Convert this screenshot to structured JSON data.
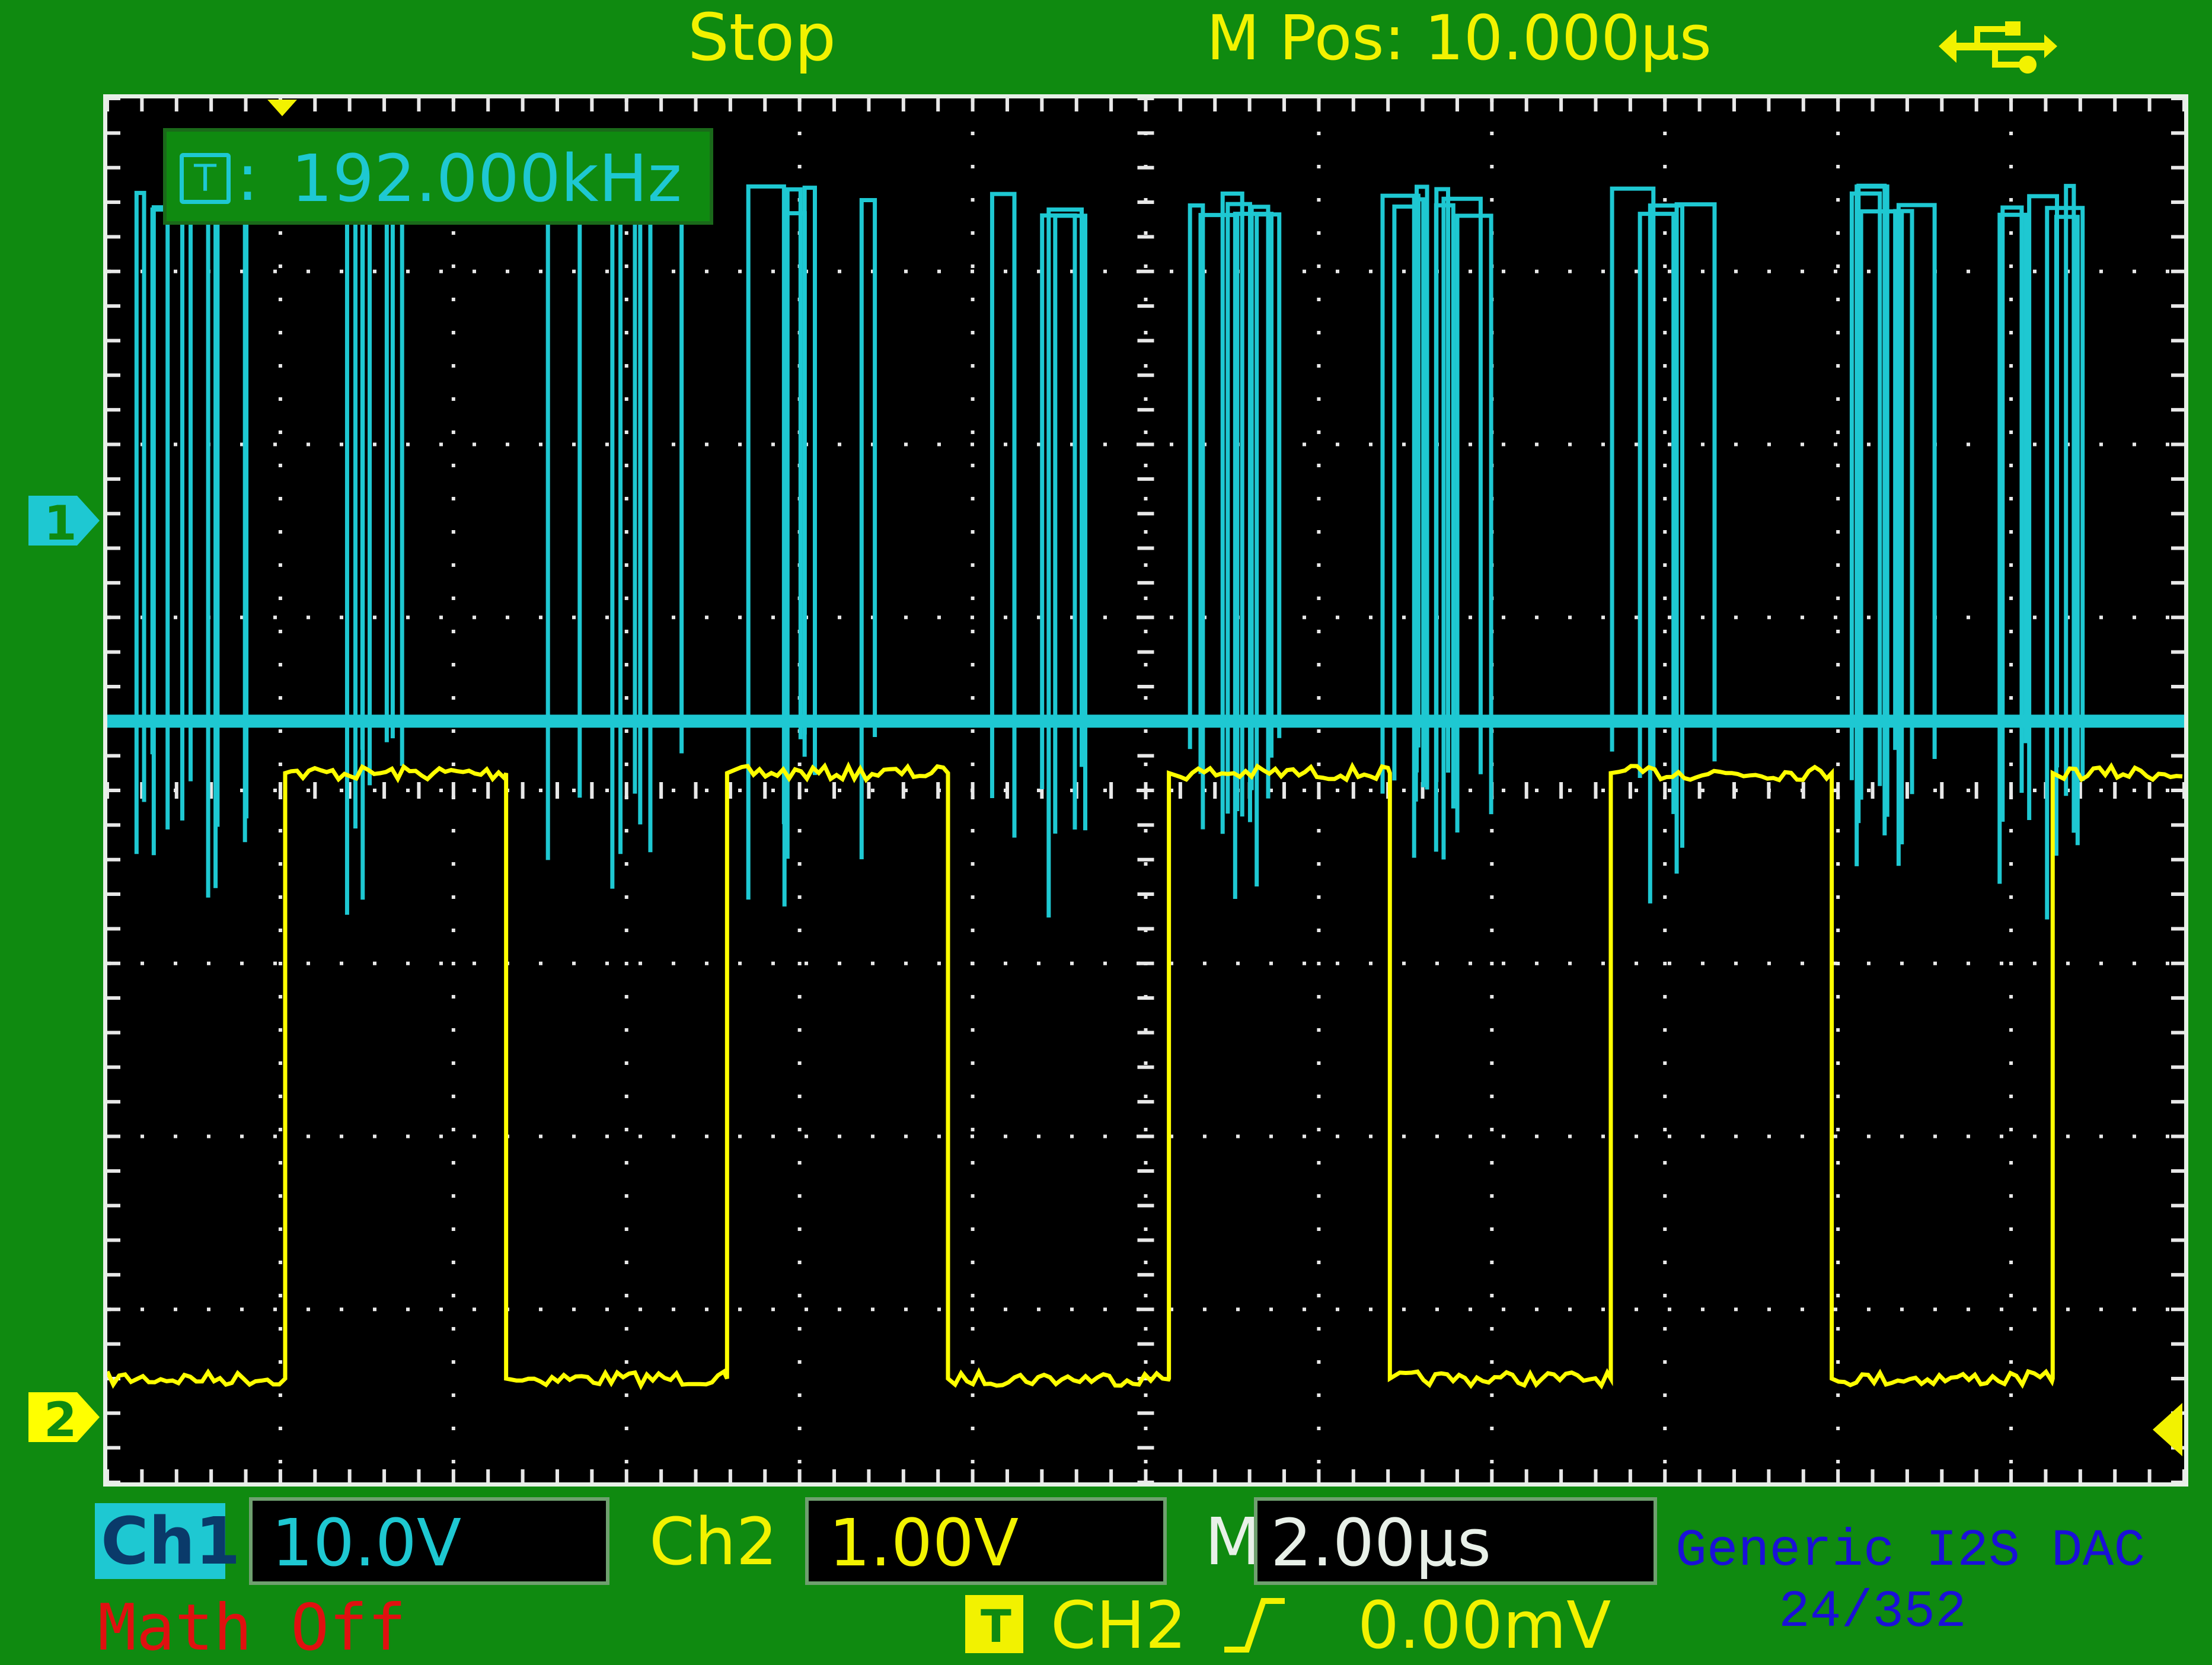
{
  "status": {
    "run_state": "Stop",
    "main_position": "M Pos: 10.000µs",
    "connection_icon": "usb-icon"
  },
  "trigger_readout": {
    "icon_letter": "T",
    "separator": ":",
    "frequency": "192.000kHz"
  },
  "channel_markers": {
    "ch1": "1",
    "ch2": "2"
  },
  "bottom": {
    "ch1_label": "Ch1",
    "ch1_scale": "10.0V",
    "ch2_label": "Ch2",
    "ch2_scale": "1.00V",
    "time_label": "M",
    "time_scale": "2.00µs",
    "math_state": "Math Off",
    "trigger_letter": "T",
    "trigger_source": "CH2",
    "trigger_slope_icon": "rising-edge-icon",
    "trigger_level": "0.00mV",
    "caption_line1": "Generic I2S DAC",
    "caption_line2": "24/352"
  },
  "colors": {
    "ch1": "#1ec8d2",
    "ch2": "#ffff00",
    "bezel": "#0f8a10",
    "grid": "#e8e8e8",
    "caption": "#1a10d8",
    "math": "#e01010"
  },
  "traces": {
    "ch2_clock": {
      "frequency_khz": 192.0,
      "cycles_visible": 4.7,
      "low_level_div": -3.4,
      "high_level_div": 0.1
    },
    "ch1_data": {
      "baseline_div": 0.4,
      "high_level_div": 3.5,
      "bursts": 10
    }
  }
}
